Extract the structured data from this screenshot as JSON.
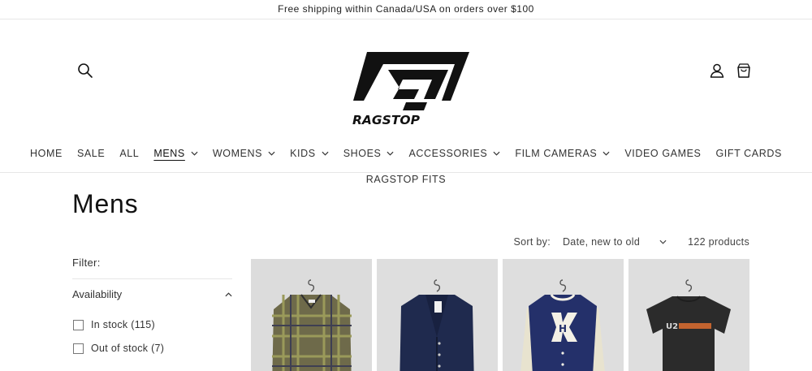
{
  "announcement": "Free shipping within Canada/USA on orders over $100",
  "header": {
    "brand": "RAGSTOP",
    "icons": {
      "search": "search-icon",
      "account": "user-icon",
      "cart": "cart-icon"
    }
  },
  "nav": {
    "items": [
      {
        "label": "HOME",
        "dropdown": false,
        "active": false
      },
      {
        "label": "SALE",
        "dropdown": false,
        "active": false
      },
      {
        "label": "ALL",
        "dropdown": false,
        "active": false
      },
      {
        "label": "MENS",
        "dropdown": true,
        "active": true
      },
      {
        "label": "WOMENS",
        "dropdown": true,
        "active": false
      },
      {
        "label": "KIDS",
        "dropdown": true,
        "active": false
      },
      {
        "label": "SHOES",
        "dropdown": true,
        "active": false
      },
      {
        "label": "ACCESSORIES",
        "dropdown": true,
        "active": false
      },
      {
        "label": "FILM CAMERAS",
        "dropdown": true,
        "active": false
      },
      {
        "label": "VIDEO GAMES",
        "dropdown": false,
        "active": false
      },
      {
        "label": "GIFT CARDS",
        "dropdown": false,
        "active": false
      }
    ],
    "second_row": "RAGSTOP FITS"
  },
  "page": {
    "title": "Mens"
  },
  "sort": {
    "label": "Sort by:",
    "selected": "Date, new to old",
    "product_count": "122 products"
  },
  "filter": {
    "title": "Filter:",
    "availability": {
      "label": "Availability",
      "options": [
        {
          "label": "In stock (115)",
          "checked": false
        },
        {
          "label": "Out of stock (7)",
          "checked": false
        }
      ]
    }
  },
  "products": [
    {
      "kind": "plaid-flannel-shirt"
    },
    {
      "kind": "navy-cardigan"
    },
    {
      "kind": "varsity-jacket"
    },
    {
      "kind": "graphic-tee",
      "print": "U2"
    }
  ],
  "colors": {
    "text": "#121212",
    "divider": "#e6e6e6",
    "image_bg": "#dedede"
  }
}
